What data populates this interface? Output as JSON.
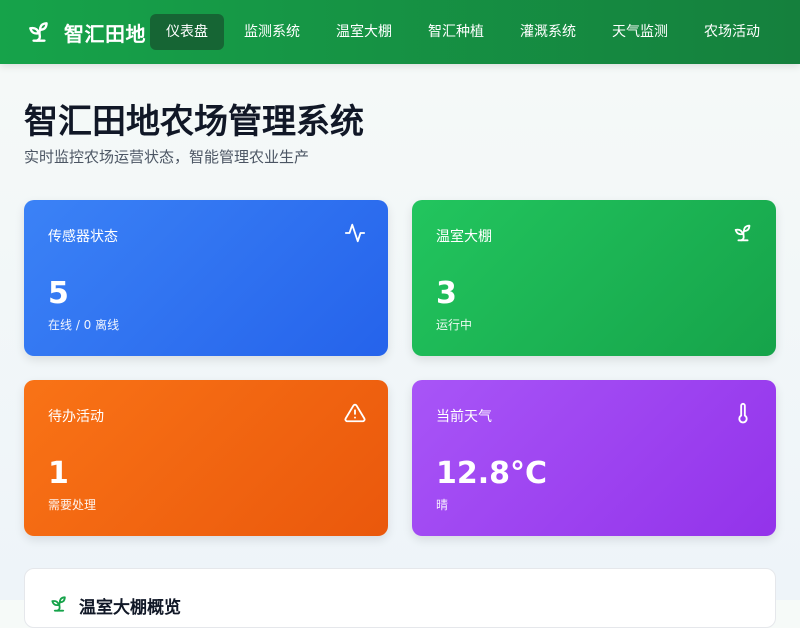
{
  "app": {
    "brand_name": "智汇田地",
    "brand_icon": "sprout-icon"
  },
  "nav": {
    "items": [
      {
        "label": "仪表盘",
        "active": true
      },
      {
        "label": "监测系统",
        "active": false
      },
      {
        "label": "温室大棚",
        "active": false
      },
      {
        "label": "智汇种植",
        "active": false
      },
      {
        "label": "灌溉系统",
        "active": false
      },
      {
        "label": "天气监测",
        "active": false
      },
      {
        "label": "农场活动",
        "active": false
      }
    ]
  },
  "header": {
    "title": "智汇田地农场管理系统",
    "subtitle": "实时监控农场运营状态，智能管理农业生产"
  },
  "cards": [
    {
      "title": "传感器状态",
      "value": "5",
      "caption": "在线 / 0 离线",
      "icon": "activity-icon",
      "color": "#3b82f6"
    },
    {
      "title": "温室大棚",
      "value": "3",
      "caption": "运行中",
      "icon": "sprout-icon",
      "color": "#22c55e"
    },
    {
      "title": "待办活动",
      "value": "1",
      "caption": "需要处理",
      "icon": "warning-icon",
      "color": "#f97316"
    },
    {
      "title": "当前天气",
      "value": "12.8°C",
      "caption": "晴",
      "icon": "thermometer-icon",
      "color": "#a855f7"
    }
  ],
  "overview": {
    "title": "温室大棚概览",
    "icon": "sprout-icon"
  },
  "colors": {
    "primary": "#16a34a",
    "nav_active": "#166534"
  }
}
